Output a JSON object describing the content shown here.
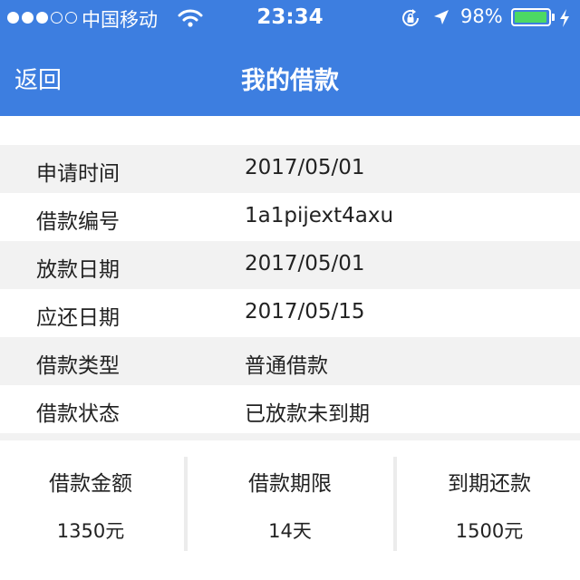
{
  "status_bar": {
    "carrier": "中国移动",
    "time": "23:34",
    "battery_percent": "98%",
    "battery_level": 0.98,
    "signal_bars_filled": 3,
    "signal_bars_total": 5,
    "icons": [
      "wifi-icon",
      "orientation-lock-icon",
      "location-arrow-icon",
      "battery-icon",
      "charging-bolt-icon"
    ]
  },
  "nav": {
    "back_label": "返回",
    "title": "我的借款"
  },
  "details": [
    {
      "label": "申请时间",
      "value": "2017/05/01"
    },
    {
      "label": "借款编号",
      "value": "1a1pijext4axu"
    },
    {
      "label": "放款日期",
      "value": "2017/05/01"
    },
    {
      "label": "应还日期",
      "value": "2017/05/15"
    },
    {
      "label": "借款类型",
      "value": "普通借款"
    },
    {
      "label": "借款状态",
      "value": "已放款未到期"
    }
  ],
  "summary": [
    {
      "label": "借款金额",
      "value": "1350元"
    },
    {
      "label": "借款期限",
      "value": "14天"
    },
    {
      "label": "到期还款",
      "value": "1500元"
    }
  ],
  "colors": {
    "header_blue": "#3d7ee0",
    "row_gray": "#f2f2f2",
    "battery_green": "#4cd964"
  }
}
